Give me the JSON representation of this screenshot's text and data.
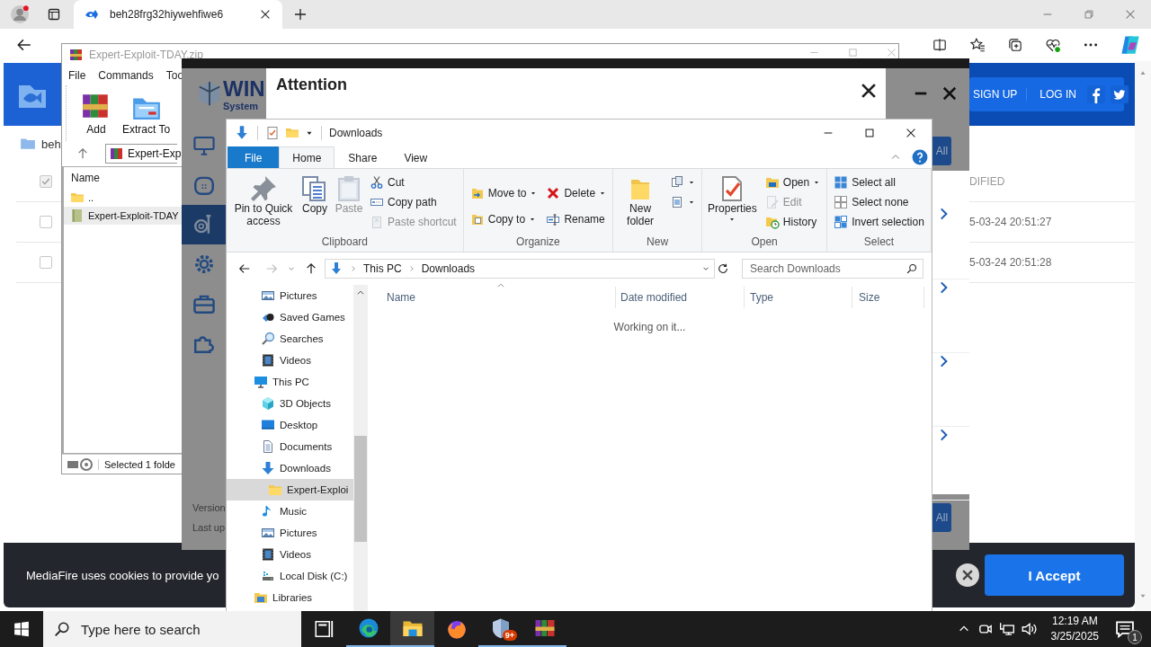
{
  "browser": {
    "tab_title": "beh28frg32hiywehfiwe6"
  },
  "mediafire": {
    "nav": [
      "SIGN UP",
      "LOG IN"
    ],
    "breadcrumb": "beh",
    "select_all": {
      "checked": true
    },
    "column": "DIFIED",
    "rows": [
      {
        "checked": false,
        "modified": "5-03-24 20:51:27"
      },
      {
        "checked": false,
        "modified": "5-03-24 20:51:28"
      }
    ],
    "cookie": {
      "text": "MediaFire uses cookies to provide yo",
      "button": "I Accept"
    }
  },
  "winrar": {
    "title": "Expert-Exploit-TDAY.zip",
    "menu": [
      "File",
      "Commands",
      "Too"
    ],
    "tools": [
      "Add",
      "Extract To"
    ],
    "path": "Expert-Exp",
    "column": "Name",
    "files": [
      {
        "name": "..",
        "kind": "parent",
        "selected": false
      },
      {
        "name": "Expert-Exploit-TDAY",
        "kind": "folder",
        "selected": true
      }
    ],
    "status": "Selected 1 folde"
  },
  "winzip": {
    "logo": "WIN",
    "logo_sub": "System",
    "sidebar": [
      {
        "selected": false
      },
      {
        "selected": false
      },
      {
        "selected": true
      },
      {
        "selected": false
      },
      {
        "selected": false
      },
      {
        "selected": false
      }
    ],
    "buttons": [
      "All",
      "All"
    ],
    "footer": [
      "Version",
      "Last up"
    ],
    "dialog": {
      "title": "Attention"
    }
  },
  "explorer": {
    "title": "Downloads",
    "tabs": [
      {
        "label": "File",
        "kind": "file",
        "selected": false
      },
      {
        "label": "Home",
        "kind": "tab",
        "selected": true
      },
      {
        "label": "Share",
        "kind": "tab",
        "selected": false
      },
      {
        "label": "View",
        "kind": "tab",
        "selected": false
      }
    ],
    "ribbon": [
      {
        "label": "Clipboard",
        "columns": [
          [
            {
              "label": "Pin to Quick access",
              "disabled": false,
              "dropdown": false
            }
          ],
          [
            {
              "label": "Copy",
              "disabled": false,
              "dropdown": false
            }
          ],
          [
            {
              "label": "Paste",
              "disabled": true,
              "dropdown": false
            }
          ],
          [
            {
              "label": "Cut",
              "disabled": false,
              "dropdown": false
            },
            {
              "label": "Copy path",
              "disabled": false,
              "dropdown": false
            },
            {
              "label": "Paste shortcut",
              "disabled": true,
              "dropdown": false
            }
          ]
        ]
      },
      {
        "label": "Organize",
        "columns": [
          [
            {
              "label": "Move to",
              "disabled": false,
              "dropdown": true
            },
            {
              "label": "Copy to",
              "disabled": false,
              "dropdown": true
            }
          ],
          [
            {
              "label": "Delete",
              "disabled": false,
              "dropdown": true
            },
            {
              "label": "Rename",
              "disabled": false,
              "dropdown": false
            }
          ]
        ]
      },
      {
        "label": "New",
        "columns": [
          [
            {
              "label": "New folder",
              "disabled": false,
              "dropdown": false
            }
          ],
          [
            {
              "disabled": false,
              "dropdown": true
            },
            {
              "disabled": false,
              "dropdown": true
            }
          ]
        ]
      },
      {
        "label": "Open",
        "columns": [
          [
            {
              "label": "Properties",
              "disabled": false,
              "dropdown": true
            }
          ],
          [
            {
              "label": "Open",
              "disabled": false,
              "dropdown": true
            },
            {
              "label": "Edit",
              "disabled": true,
              "dropdown": false
            },
            {
              "label": "History",
              "disabled": false,
              "dropdown": false
            }
          ]
        ]
      },
      {
        "label": "Select",
        "columns": [
          [
            {
              "label": "Select all",
              "disabled": false,
              "dropdown": false
            },
            {
              "label": "Select none",
              "disabled": false,
              "dropdown": false
            },
            {
              "label": "Invert selection",
              "disabled": false,
              "dropdown": false
            }
          ]
        ]
      }
    ],
    "address": [
      "This PC",
      "Downloads"
    ],
    "search_placeholder": "Search Downloads",
    "columns": [
      {
        "label": "Name",
        "sorted": true
      },
      {
        "label": "Date modified",
        "sorted": false
      },
      {
        "label": "Type",
        "sorted": false
      },
      {
        "label": "Size",
        "sorted": false
      }
    ],
    "status": "Working on it...",
    "tree": [
      {
        "kind": "continued",
        "children": [
          {
            "label": "Pictures",
            "kind": "pictures",
            "selected": false
          },
          {
            "label": "Saved Games",
            "kind": "games",
            "selected": false
          },
          {
            "label": "Searches",
            "kind": "search",
            "selected": false
          },
          {
            "label": "Videos",
            "kind": "videos",
            "selected": false
          }
        ]
      },
      {
        "label": "This PC",
        "kind": "pc",
        "selected": false,
        "children": [
          {
            "label": "3D Objects",
            "kind": "objects",
            "selected": false
          },
          {
            "label": "Desktop",
            "kind": "desktop",
            "selected": false
          },
          {
            "label": "Documents",
            "kind": "documents",
            "selected": false
          },
          {
            "label": "Downloads",
            "kind": "downloads",
            "selected": false,
            "children": [
              {
                "label": "Expert-Exploi",
                "kind": "folder",
                "selected": true
              }
            ]
          },
          {
            "label": "Music",
            "kind": "music",
            "selected": false
          },
          {
            "label": "Pictures",
            "kind": "pictures",
            "selected": false
          },
          {
            "label": "Videos",
            "kind": "videos",
            "selected": false
          },
          {
            "label": "Local Disk (C:)",
            "kind": "disk",
            "selected": false
          }
        ]
      },
      {
        "label": "Libraries",
        "kind": "libraries",
        "selected": false
      }
    ]
  },
  "taskbar": {
    "search_placeholder": "Type here to search",
    "apps": [
      {
        "kind": "taskview",
        "running": false,
        "selected": false
      },
      {
        "kind": "edge",
        "running": true,
        "selected": false
      },
      {
        "kind": "explorer",
        "running": true,
        "selected": true
      },
      {
        "kind": "firefox",
        "running": false,
        "selected": false
      },
      {
        "kind": "shield",
        "running": true,
        "selected": false,
        "badge": "9+"
      },
      {
        "kind": "winrar",
        "running": true,
        "selected": false
      }
    ],
    "time": "12:19 AM",
    "date": "3/25/2025",
    "notifications": "1"
  }
}
